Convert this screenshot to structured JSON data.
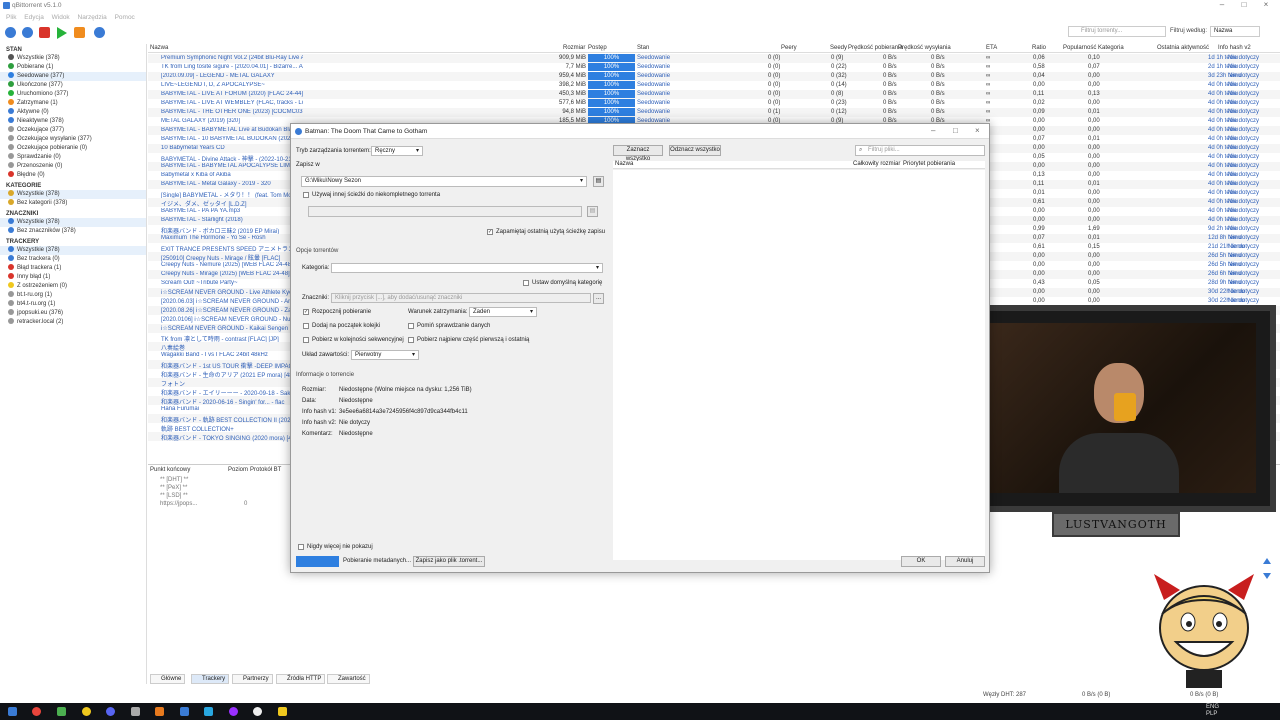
{
  "app": {
    "title": "qBittorrent v5.1.0"
  },
  "menu": [
    "Plik",
    "Edycja",
    "Widok",
    "Narzędzia",
    "Pomoc"
  ],
  "toolbar": {
    "search_placeholder": "Filtruj torrenty...",
    "filter_label": "Filtruj według:",
    "filter_value": "Nazwa"
  },
  "sidebar": {
    "status_header": "STAN",
    "status": [
      "Wszystkie (378)",
      "Pobierane (1)",
      "Seedowane (377)",
      "Ukończone (377)",
      "Uruchomiono (377)",
      "Zatrzymane (1)",
      "Aktywne (0)",
      "Nieaktywne (378)",
      "Oczekujące (377)",
      "Oczekujące wysyłanie (377)",
      "Oczekujące pobieranie (0)",
      "Sprawdzanie (0)",
      "Przenoszenie (0)",
      "Błędne (0)"
    ],
    "categories_header": "KATEGORIE",
    "categories": [
      "Wszystkie (378)",
      "Bez kategorii (378)"
    ],
    "tags_header": "ZNACZNIKI",
    "tags": [
      "Wszystkie (378)",
      "Bez znaczników (378)"
    ],
    "trackers_header": "TRACKERY",
    "trackers": [
      "Wszystkie (378)",
      "Bez trackera (0)",
      "Błąd trackera (1)",
      "Inny błąd (1)",
      "Z ostrzeżeniem (0)",
      "bt.t-ru.org (1)",
      "bt4.t-ru.org (1)",
      "jpopsuki.eu (376)",
      "retracker.local (2)"
    ]
  },
  "columns": [
    "Nazwa",
    "Rozmiar",
    "Postęp",
    "Stan",
    "Peery",
    "Seedy",
    "Prędkość pobierania",
    "Prędkość wysyłania",
    "ETA",
    "Ratio",
    "Popularność",
    "Kategoria",
    "Ostatnia aktywność",
    "Info hash v2"
  ],
  "rows": [
    {
      "name": "Premium Symphonic Night Vol.2 (24bit Blu-Ray Live Album)",
      "size": "909,9 MiB",
      "progress": "100%",
      "status": "Seedowanie",
      "peers": "0 (0)",
      "seeds": "0 (9)",
      "dl": "0 B/s",
      "ul": "0 B/s",
      "eta": "∞",
      "ratio": "0,06",
      "pop": "0,10",
      "active": "1d 1h temu",
      "hash": "Nie dotyczy"
    },
    {
      "name": "TK from Ling tosite sigure - [2020.04.01] - Bizarre... AAC (320)",
      "size": "7,7 MiB",
      "progress": "100%",
      "status": "Seedowanie",
      "peers": "0 (0)",
      "seeds": "0 (22)",
      "dl": "0 B/s",
      "ul": "0 B/s",
      "eta": "∞",
      "ratio": "0,58",
      "pop": "0,07",
      "active": "2d 1h temu",
      "hash": "Nie dotyczy"
    },
    {
      "name": "[2020.09.09] - LEGEND - METAL GALAXY",
      "size": "959,4 MiB",
      "progress": "100%",
      "status": "Seedowanie",
      "peers": "0 (0)",
      "seeds": "0 (32)",
      "dl": "0 B/s",
      "ul": "0 B/s",
      "eta": "∞",
      "ratio": "0,04",
      "pop": "0,00",
      "active": "3d 23h temu",
      "hash": "Nie dotyczy"
    },
    {
      "name": "LIVE~LEGEND I, D, Z APOCALYPSE~",
      "size": "398,2 MiB",
      "progress": "100%",
      "status": "Seedowanie",
      "peers": "0 (0)",
      "seeds": "0 (14)",
      "dl": "0 B/s",
      "ul": "0 B/s",
      "eta": "∞",
      "ratio": "0,00",
      "pop": "0,00",
      "active": "4d 0h temu",
      "hash": "Nie dotyczy"
    },
    {
      "name": "BABYMETAL - LIVE AT FORUM (2020) [FLAC 24-44] [Capitol Records, 00024715510]",
      "size": "450,3 MiB",
      "progress": "100%",
      "status": "Seedowanie",
      "peers": "0 (0)",
      "seeds": "0 (8)",
      "dl": "0 B/s",
      "ul": "0 B/s",
      "eta": "∞",
      "ratio": "0,11",
      "pop": "0,13",
      "active": "4d 0h temu",
      "hash": "Nie dotyczy"
    },
    {
      "name": "BABYMETAL - LIVE AT WEMBLEY (FLAC, tracks - Lossless - CD - 2016)",
      "size": "577,6 MiB",
      "progress": "100%",
      "status": "Seedowanie",
      "peers": "0 (0)",
      "seeds": "0 (23)",
      "dl": "0 B/s",
      "ul": "0 B/s",
      "eta": "∞",
      "ratio": "0,02",
      "pop": "0,00",
      "active": "4d 0h temu",
      "hash": "Nie dotyczy"
    },
    {
      "name": "BABYMETAL - THE OTHER ONE (2023) [COCMC0375] [CD MP3 320]",
      "size": "94,8 MiB",
      "progress": "100%",
      "status": "Seedowanie",
      "peers": "0 (1)",
      "seeds": "0 (12)",
      "dl": "0 B/s",
      "ul": "0 B/s",
      "eta": "∞",
      "ratio": "0,09",
      "pop": "0,01",
      "active": "4d 0h temu",
      "hash": "Nie dotyczy"
    },
    {
      "name": "METAL GALAXY (2019) [320]",
      "size": "185,5 MiB",
      "progress": "100%",
      "status": "Seedowanie",
      "peers": "0 (0)",
      "seeds": "0 (9)",
      "dl": "0 B/s",
      "ul": "0 B/s",
      "eta": "∞",
      "ratio": "0,00",
      "pop": "0,00",
      "active": "4d 0h temu",
      "hash": "Nie dotyczy"
    },
    {
      "name": "BABYMETAL - BABYMETAL Live at Budokan Black Night",
      "size": "",
      "progress": "",
      "status": "",
      "peers": "",
      "seeds": "",
      "dl": "",
      "ul": "",
      "eta": "",
      "ratio": "0,00",
      "pop": "0,00",
      "active": "4d 0h temu",
      "hash": "Nie dotyczy"
    },
    {
      "name": "BABYMETAL - 10 BABYMETAL BUDOKAN (2021 LIVE)",
      "size": "",
      "progress": "",
      "status": "",
      "peers": "",
      "seeds": "",
      "dl": "",
      "ul": "",
      "eta": "",
      "ratio": "0,07",
      "pop": "0,01",
      "active": "4d 0h temu",
      "hash": "Nie dotyczy"
    },
    {
      "name": "10 Babymetal Years CD",
      "size": "",
      "progress": "",
      "status": "",
      "peers": "",
      "seeds": "",
      "dl": "",
      "ul": "",
      "eta": "",
      "ratio": "0,00",
      "pop": "0,00",
      "active": "4d 0h temu",
      "hash": "Nie dotyczy"
    },
    {
      "name": "BABYMETAL - Divine Attack - 神撃 - (2022-10-21)",
      "size": "",
      "progress": "",
      "status": "",
      "peers": "",
      "seeds": "",
      "dl": "",
      "ul": "",
      "eta": "",
      "ratio": "0,05",
      "pop": "0,00",
      "active": "4d 0h temu",
      "hash": "Nie dotyczy"
    },
    {
      "name": "BABYMETAL - BABYMETAL APOCALYPSE LIMITED",
      "size": "",
      "progress": "",
      "status": "",
      "peers": "",
      "seeds": "",
      "dl": "",
      "ul": "",
      "eta": "",
      "ratio": "0,00",
      "pop": "0,00",
      "active": "4d 0h temu",
      "hash": "Nie dotyczy"
    },
    {
      "name": "Babymetal x Kiba of Akiba",
      "size": "",
      "progress": "",
      "status": "",
      "peers": "",
      "seeds": "",
      "dl": "",
      "ul": "",
      "eta": "",
      "ratio": "0,13",
      "pop": "0,00",
      "active": "4d 0h temu",
      "hash": "Nie dotyczy"
    },
    {
      "name": "BABYMETAL - Metal Galaxy - 2019 - 320",
      "size": "",
      "progress": "",
      "status": "",
      "peers": "",
      "seeds": "",
      "dl": "",
      "ul": "",
      "eta": "",
      "ratio": "0,11",
      "pop": "0,01",
      "active": "4d 0h temu",
      "hash": "Nie dotyczy"
    },
    {
      "name": "[Single] BABYMETAL - メタり！！ (feat. Tom Morello)",
      "size": "",
      "progress": "",
      "status": "",
      "peers": "",
      "seeds": "",
      "dl": "",
      "ul": "",
      "eta": "",
      "ratio": "0,01",
      "pop": "0,00",
      "active": "4d 0h temu",
      "hash": "Nie dotyczy"
    },
    {
      "name": "イジメ、ダメ、ゼッタイ [L.D.Z]",
      "size": "",
      "progress": "",
      "status": "",
      "peers": "",
      "seeds": "",
      "dl": "",
      "ul": "",
      "eta": "",
      "ratio": "0,61",
      "pop": "0,00",
      "active": "4d 0h temu",
      "hash": "Nie dotyczy"
    },
    {
      "name": "BABYMETAL - PA PA YA.mp3",
      "size": "",
      "progress": "",
      "status": "",
      "peers": "",
      "seeds": "",
      "dl": "",
      "ul": "",
      "eta": "",
      "ratio": "0,00",
      "pop": "0,00",
      "active": "4d 0h temu",
      "hash": "Nie dotyczy"
    },
    {
      "name": "BABYMETAL - Starlight (2018)",
      "size": "",
      "progress": "",
      "status": "",
      "peers": "",
      "seeds": "",
      "dl": "",
      "ul": "",
      "eta": "",
      "ratio": "0,00",
      "pop": "0,00",
      "active": "4d 0h temu",
      "hash": "Nie dotyczy"
    },
    {
      "name": "和楽器バンド - ボカロ三昧2 (2019 EP Mirai)",
      "size": "",
      "progress": "",
      "status": "",
      "peers": "",
      "seeds": "",
      "dl": "",
      "ul": "",
      "eta": "",
      "ratio": "0,99",
      "pop": "1,69",
      "active": "9d 2h temu",
      "hash": "Nie dotyczy"
    },
    {
      "name": "Maximum The Hormone - Yo Se - Rosh",
      "size": "",
      "progress": "",
      "status": "",
      "peers": "",
      "seeds": "",
      "dl": "",
      "ul": "",
      "eta": "",
      "ratio": "0,07",
      "pop": "0,01",
      "active": "12d 8h temu",
      "hash": "Nie dotyczy"
    },
    {
      "name": "EXIT TRANCE PRESENTS SPEED アニメトランス BEST",
      "size": "",
      "progress": "",
      "status": "",
      "peers": "",
      "seeds": "",
      "dl": "",
      "ul": "",
      "eta": "",
      "ratio": "0,61",
      "pop": "0,15",
      "active": "21d 21h temu",
      "hash": "Nie dotyczy"
    },
    {
      "name": "[250910] Creepy Nuts - Mirage / 眩暈 [FLAC]",
      "size": "",
      "progress": "",
      "status": "",
      "peers": "",
      "seeds": "",
      "dl": "",
      "ul": "",
      "eta": "",
      "ratio": "0,00",
      "pop": "0,00",
      "active": "26d 5h temu",
      "hash": "Nie dotyczy"
    },
    {
      "name": "Creepy Nuts - Nemure (2025) [WEB FLAC 24-48]",
      "size": "",
      "progress": "",
      "status": "",
      "peers": "",
      "seeds": "",
      "dl": "",
      "ul": "",
      "eta": "",
      "ratio": "0,00",
      "pop": "0,00",
      "active": "26d 5h temu",
      "hash": "Nie dotyczy"
    },
    {
      "name": "Creepy Nuts - Mirage (2025) [WEB FLAC 24-48]",
      "size": "",
      "progress": "",
      "status": "",
      "peers": "",
      "seeds": "",
      "dl": "",
      "ul": "",
      "eta": "",
      "ratio": "0,00",
      "pop": "0,00",
      "active": "26d 6h temu",
      "hash": "Nie dotyczy"
    },
    {
      "name": "Scream Out! ~Tribute Party~",
      "size": "",
      "progress": "",
      "status": "",
      "peers": "",
      "seeds": "",
      "dl": "",
      "ul": "",
      "eta": "",
      "ratio": "0,43",
      "pop": "0,05",
      "active": "28d 9h temu",
      "hash": "Nie dotyczy"
    },
    {
      "name": "i☆SCREAM NEVER GROUND - Live Athlete Kyouka",
      "size": "",
      "progress": "",
      "status": "",
      "peers": "",
      "seeds": "",
      "dl": "",
      "ul": "",
      "eta": "",
      "ratio": "0,00",
      "pop": "0,00",
      "active": "30d 22h temu",
      "hash": "Nie dotyczy"
    },
    {
      "name": "[2020.06.03] i☆SCREAM NEVER GROUND - Ano Wareno",
      "size": "",
      "progress": "",
      "status": "",
      "peers": "",
      "seeds": "",
      "dl": "",
      "ul": "",
      "eta": "",
      "ratio": "0,00",
      "pop": "0,00",
      "active": "30d 22h temu",
      "hash": "Nie dotyczy"
    },
    {
      "name": "[2020.08.26] i☆SCREAM NEVER GROUND - Zaviyoku Natsu Ga",
      "size": "",
      "progress": "",
      "status": "",
      "peers": "",
      "seeds": "",
      "dl": "",
      "ul": "",
      "eta": "",
      "ratio": "",
      "pop": "",
      "active": "",
      "hash": ""
    },
    {
      "name": "[2020.0106] i☆SCREAM NEVER GROUND - Nummer",
      "size": "",
      "progress": "",
      "status": "",
      "peers": "",
      "seeds": "",
      "dl": "",
      "ul": "",
      "eta": "",
      "ratio": "",
      "pop": "",
      "active": "",
      "hash": ""
    },
    {
      "name": "i☆SCREAM NEVER GROUND - Kaikai Sengen (2017)",
      "size": "",
      "progress": "",
      "status": "",
      "peers": "",
      "seeds": "",
      "dl": "",
      "ul": "",
      "eta": "",
      "ratio": "",
      "pop": "",
      "active": "",
      "hash": ""
    },
    {
      "name": "TK from 凛として時雨 - contrast [FLAC] [JP]",
      "size": "",
      "progress": "",
      "status": "",
      "peers": "",
      "seeds": "",
      "dl": "",
      "ul": "",
      "eta": "",
      "ratio": "",
      "pop": "",
      "active": "",
      "hash": ""
    },
    {
      "name": "八奏絵巻",
      "size": "",
      "progress": "",
      "status": "",
      "peers": "",
      "seeds": "",
      "dl": "",
      "ul": "",
      "eta": "",
      "ratio": "",
      "pop": "",
      "active": "",
      "hash": ""
    },
    {
      "name": "Wagakki Band - I vs I FLAC 24bit 48kHz",
      "size": "",
      "progress": "",
      "status": "",
      "peers": "",
      "seeds": "",
      "dl": "",
      "ul": "",
      "eta": "",
      "ratio": "",
      "pop": "",
      "active": "",
      "hash": ""
    },
    {
      "name": "和楽器バンド - 1st US TOUR 衝撃 -DEEP IMPACT-",
      "size": "",
      "progress": "",
      "status": "",
      "peers": "",
      "seeds": "",
      "dl": "",
      "ul": "",
      "eta": "",
      "ratio": "",
      "pop": "",
      "active": "",
      "hash": ""
    },
    {
      "name": "和楽器バンド - 生命のアリア (2021 EP mora) [48-24]",
      "size": "",
      "progress": "",
      "status": "",
      "peers": "",
      "seeds": "",
      "dl": "",
      "ul": "",
      "eta": "",
      "ratio": "",
      "pop": "",
      "active": "",
      "hash": ""
    },
    {
      "name": "フォトン",
      "size": "",
      "progress": "",
      "status": "",
      "peers": "",
      "seeds": "",
      "dl": "",
      "ul": "",
      "eta": "",
      "ratio": "",
      "pop": "",
      "active": "",
      "hash": ""
    },
    {
      "name": "和楽器バンド - エイリーーー - 2020-09-18 - Sakura Rain",
      "size": "",
      "progress": "",
      "status": "",
      "peers": "",
      "seeds": "",
      "dl": "",
      "ul": "",
      "eta": "",
      "ratio": "",
      "pop": "",
      "active": "",
      "hash": ""
    },
    {
      "name": "和楽器バンド - 2020-06-16 - Singin' for... - flac",
      "size": "",
      "progress": "",
      "status": "",
      "peers": "",
      "seeds": "",
      "dl": "",
      "ul": "",
      "eta": "",
      "ratio": "",
      "pop": "",
      "active": "",
      "hash": ""
    },
    {
      "name": "Hana Furumai",
      "size": "",
      "progress": "",
      "status": "",
      "peers": "",
      "seeds": "",
      "dl": "",
      "ul": "",
      "eta": "",
      "ratio": "",
      "pop": "",
      "active": "",
      "hash": ""
    },
    {
      "name": "和楽器バンド - 軌跡 BEST COLLECTION II (2020)",
      "size": "",
      "progress": "",
      "status": "",
      "peers": "",
      "seeds": "",
      "dl": "",
      "ul": "",
      "eta": "",
      "ratio": "",
      "pop": "",
      "active": "",
      "hash": ""
    },
    {
      "name": "軌跡 BEST COLLECTION+",
      "size": "",
      "progress": "",
      "status": "",
      "peers": "",
      "seeds": "",
      "dl": "",
      "ul": "",
      "eta": "",
      "ratio": "",
      "pop": "",
      "active": "",
      "hash": ""
    },
    {
      "name": "和楽器バンド - TOKYO SINGING (2020 mora) [48-24]",
      "size": "",
      "progress": "",
      "status": "",
      "peers": "",
      "seeds": "",
      "dl": "",
      "ul": "",
      "eta": "",
      "ratio": "",
      "pop": "",
      "active": "",
      "hash": ""
    }
  ],
  "lower": {
    "col1": "Punkt końcowy",
    "col2": "Poziom",
    "col3": "Protokół BT",
    "lines": [
      "** [DHT] **",
      "** [PeX] **",
      "** [LSD] **",
      "https://jpops..."
    ],
    "lastval": "0"
  },
  "tabs": [
    "Główne",
    "Trackery",
    "Partnerzy",
    "Źródła HTTP",
    "Zawartość"
  ],
  "status": {
    "dht": "Węzły DHT: 287",
    "speed_dl": "0 B/s (0 B)",
    "speed_ul": "0 B/s (0 B)"
  },
  "clock": {
    "lang1": "ENG",
    "lang2": "PLP"
  },
  "dialog": {
    "title": "Batman: The Doom That Came to Gotham",
    "mgmt_label": "Tryb zarządzania torrentem:",
    "mgmt_value": "Ręczny",
    "save_in": "Zapisz w",
    "save_path": "G:\\Miku\\Nowy Sezon",
    "other_path": "Używaj innej ścieżki do niekompletnego torrenta",
    "remember": "Zapamiętaj ostatnią użytą ścieżkę zapisu",
    "opts": "Opcje torrentów",
    "category": "Kategoria:",
    "default_cat": "Ustaw domyślną kategorię",
    "tags_label": "Znaczniki:",
    "tags_placeholder": "Kliknij przycisk [...], aby dodać/usunąć znaczniki",
    "tags_btn": "...",
    "start": "Rozpocznij pobieranie",
    "stop_cond_label": "Warunek zatrzymania:",
    "stop_cond_value": "Żaden",
    "top_queue": "Dodaj na początek kolejki",
    "skip_check": "Pomiń sprawdzanie danych",
    "sequential": "Pobierz w kolejności sekwencyjnej",
    "first_last": "Pobierz najpierw część pierwszą i ostatnią",
    "layout_label": "Układ zawartości:",
    "layout_value": "Pierwotny",
    "info": "Informacje o torrencie",
    "size_label": "Rozmiar:",
    "size_value": "Niedostępne (Wolne miejsce na dysku: 1,256 TiB)",
    "date_label": "Data:",
    "date_value": "Niedostępne",
    "hash1_label": "Info hash v1:",
    "hash1_value": "3e5ee6a6814a3e7245956f4c897d9ca344fb4c11",
    "hash2_label": "Info hash v2:",
    "hash2_value": "Nie dotyczy",
    "comment_label": "Komentarz:",
    "comment_value": "Niedostępne",
    "select_all": "Zaznacz wszystko",
    "deselect_all": "Odznacz wszystko",
    "filter_placeholder": "Filtruj pliki...",
    "col_name": "Nazwa",
    "col_size": "Całkowity rozmiar",
    "col_prio": "Priorytet pobierania",
    "never_show": "Nigdy więcej nie pokazuj",
    "metadata": "Pobieranie metadanych...",
    "save_torrent": "Zapisz jako plik .torrent...",
    "ok": "OK",
    "cancel": "Anuluj"
  },
  "overlay": {
    "nameplate": "LUSTVANGOTH"
  },
  "colors": {
    "accent": "#2e7fe0",
    "link": "#2e5fb8"
  }
}
